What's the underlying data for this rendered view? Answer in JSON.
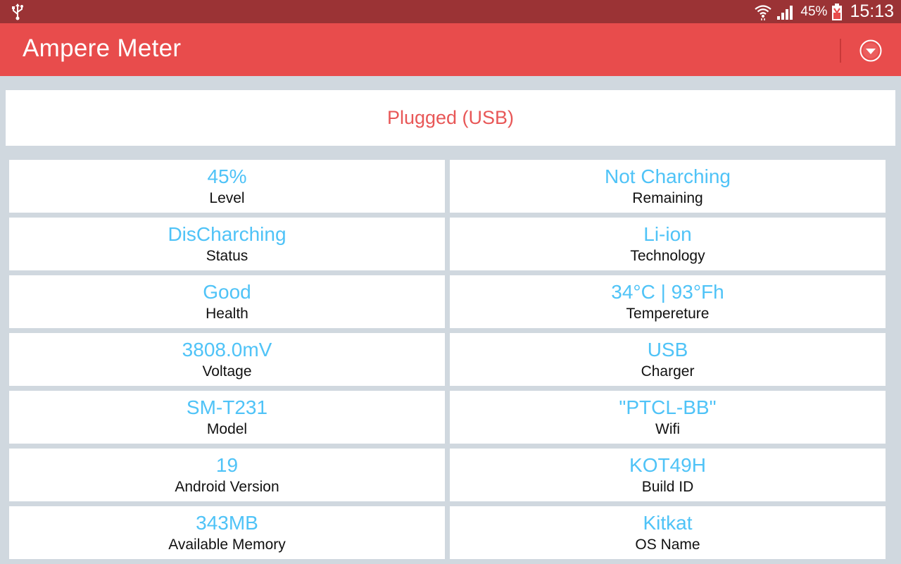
{
  "status_bar": {
    "battery_percent": "45%",
    "time": "15:13"
  },
  "app_bar": {
    "title": "Ampere Meter"
  },
  "plug_status": "Plugged (USB)",
  "rows": [
    [
      {
        "value": "45%",
        "label": "Level"
      },
      {
        "value": "Not Charching",
        "label": "Remaining"
      }
    ],
    [
      {
        "value": "DisCharching",
        "label": "Status"
      },
      {
        "value": "Li-ion",
        "label": "Technology"
      }
    ],
    [
      {
        "value": "Good",
        "label": "Health"
      },
      {
        "value": "34°C | 93°Fh",
        "label": "Tempereture"
      }
    ],
    [
      {
        "value": "3808.0mV",
        "label": "Voltage"
      },
      {
        "value": "USB",
        "label": "Charger"
      }
    ],
    [
      {
        "value": "SM-T231",
        "label": "Model"
      },
      {
        "value": "\"PTCL-BB\"",
        "label": "Wifi"
      }
    ],
    [
      {
        "value": "19",
        "label": "Android Version"
      },
      {
        "value": "KOT49H",
        "label": "Build ID"
      }
    ],
    [
      {
        "value": "343MB",
        "label": "Available Memory"
      },
      {
        "value": "Kitkat",
        "label": "OS Name"
      }
    ]
  ],
  "colors": {
    "status_bar": "#9b3335",
    "app_bar": "#e84c4c",
    "value_text": "#4fc3f7",
    "plug_text": "#e85757",
    "background": "#d0d8df"
  },
  "icons": {
    "usb": "usb-icon",
    "wifi": "wifi-icon",
    "signal": "signal-icon",
    "battery": "battery-icon",
    "menu": "dropdown-circle-icon"
  }
}
